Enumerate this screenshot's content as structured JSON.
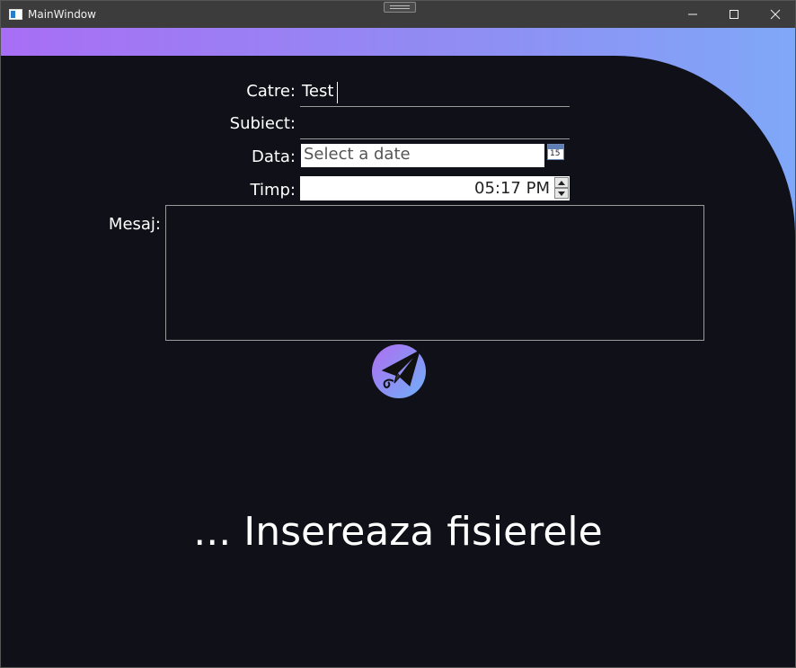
{
  "window": {
    "title": "MainWindow"
  },
  "form": {
    "to_label": "Catre:",
    "to_value": "Test",
    "subject_label": "Subiect:",
    "subject_value": "",
    "date_label": "Data:",
    "date_placeholder": "Select a date",
    "calendar_day": "15",
    "time_label": "Timp:",
    "time_value": "05:17 PM",
    "message_label": "Mesaj:",
    "message_value": ""
  },
  "drop_zone": {
    "text": "... Insereaza fisierele"
  },
  "colors": {
    "background": "#101018",
    "gradient_start": "#a86ef5",
    "gradient_end": "#7fa8f8",
    "titlebar": "#3c3c3c"
  },
  "icons": {
    "send": "paper-plane-icon",
    "calendar": "calendar-icon"
  }
}
